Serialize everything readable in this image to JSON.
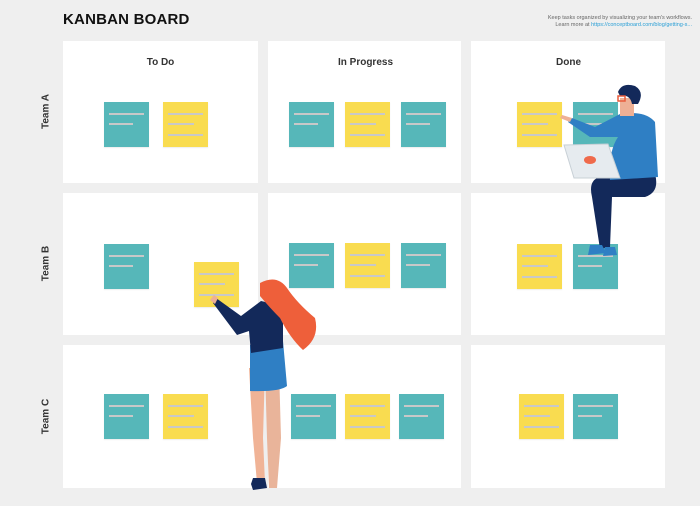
{
  "header": {
    "title": "KANBAN BOARD",
    "description": "Keep tasks organized by visualizing your team's workflows.",
    "learn_more_prefix": "Learn more at",
    "learn_more_link": "https://conceptboard.com/blog/getting-s..."
  },
  "columns": [
    "To Do",
    "In Progress",
    "Done"
  ],
  "rows": [
    "Team A",
    "Team B",
    "Team C"
  ],
  "colors": {
    "teal": "#56b7b9",
    "yellow": "#f9dc50",
    "background": "#efefef",
    "line": "#c8c8c8"
  },
  "notes": [
    [
      [
        "teal",
        "yellow"
      ],
      [
        "teal",
        "yellow",
        "teal"
      ],
      [
        "yellow",
        "teal"
      ]
    ],
    [
      [
        "teal",
        "yellow"
      ],
      [
        "teal",
        "yellow",
        "teal"
      ],
      [
        "yellow",
        "teal"
      ]
    ],
    [
      [
        "teal",
        "yellow"
      ],
      [
        "teal",
        "yellow",
        "teal"
      ],
      [
        "yellow",
        "teal"
      ]
    ]
  ],
  "illustrations": [
    "man-with-laptop",
    "woman-placing-note"
  ]
}
